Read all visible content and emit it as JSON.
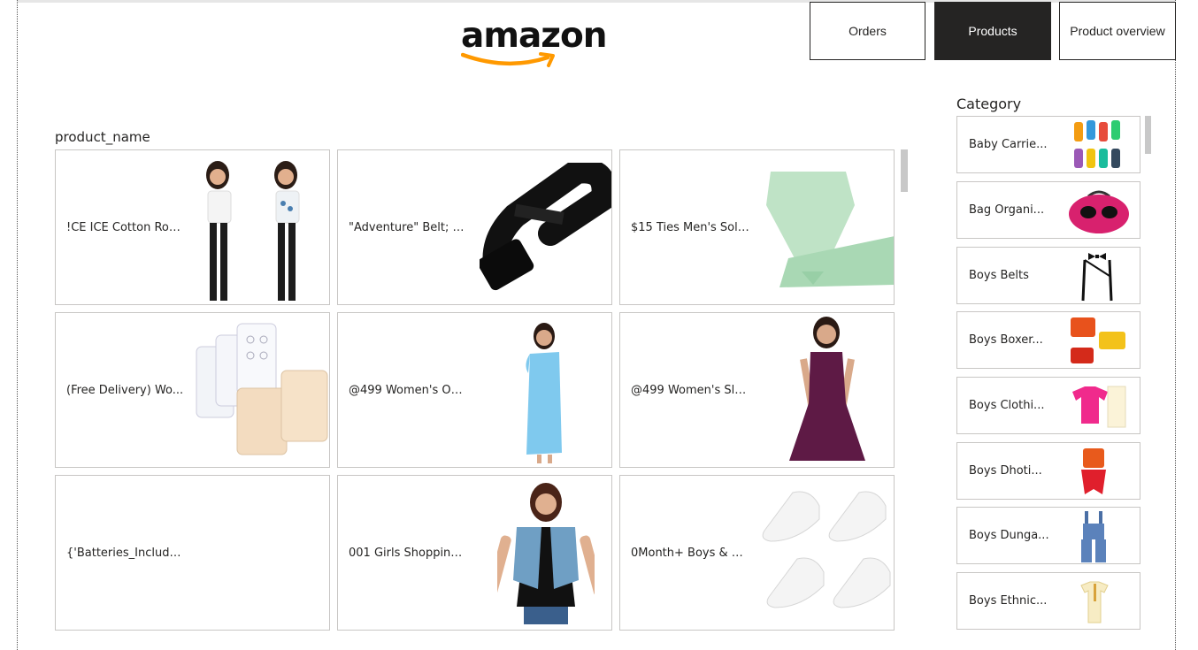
{
  "brand": {
    "logo_text": "amazon",
    "smile_color": "#ff9900",
    "text_color": "#111111"
  },
  "nav": {
    "buttons": [
      {
        "label": "Orders",
        "active": false
      },
      {
        "label": "Products",
        "active": true
      },
      {
        "label": "Product overview",
        "active": false
      }
    ]
  },
  "products": {
    "title": "product_name",
    "cards": [
      {
        "label": "!CE ICE Cotton Rou...",
        "image": "two-girls-tshirts"
      },
      {
        "label": "\"Adventure\" Belt; 1....",
        "image": "black-belt"
      },
      {
        "label": "$15 Ties Men's Soli...",
        "image": "mint-tie"
      },
      {
        "label": "(Free Delivery) Wo...",
        "image": "bra-extenders"
      },
      {
        "label": "@499 Women's Off ...",
        "image": "blue-dress"
      },
      {
        "label": "@499 Women's Sle...",
        "image": "purple-dress"
      },
      {
        "label": "{'Batteries_Include...",
        "image": ""
      },
      {
        "label": "001 Girls Shopping ...",
        "image": "denim-vest"
      },
      {
        "label": "0Month+ Boys & Gi...",
        "image": "white-socks"
      }
    ]
  },
  "category": {
    "title": "Category",
    "items": [
      {
        "label": "Baby Carrie...",
        "image": "colorful-socks"
      },
      {
        "label": "Bag Organi...",
        "image": "pink-bag"
      },
      {
        "label": "Boys Belts",
        "image": "suspenders"
      },
      {
        "label": "Boys Boxer...",
        "image": "boxers"
      },
      {
        "label": "Boys Clothi...",
        "image": "pink-shirt"
      },
      {
        "label": "Boys Dhoti...",
        "image": "dhoti"
      },
      {
        "label": "Boys Dunga...",
        "image": "dungarees"
      },
      {
        "label": "Boys Ethnic...",
        "image": "ethnic-wear"
      }
    ]
  },
  "colors": {
    "dark": "#252423",
    "border": "#c8c6c4",
    "scrollbar": "#c8c8c8"
  }
}
